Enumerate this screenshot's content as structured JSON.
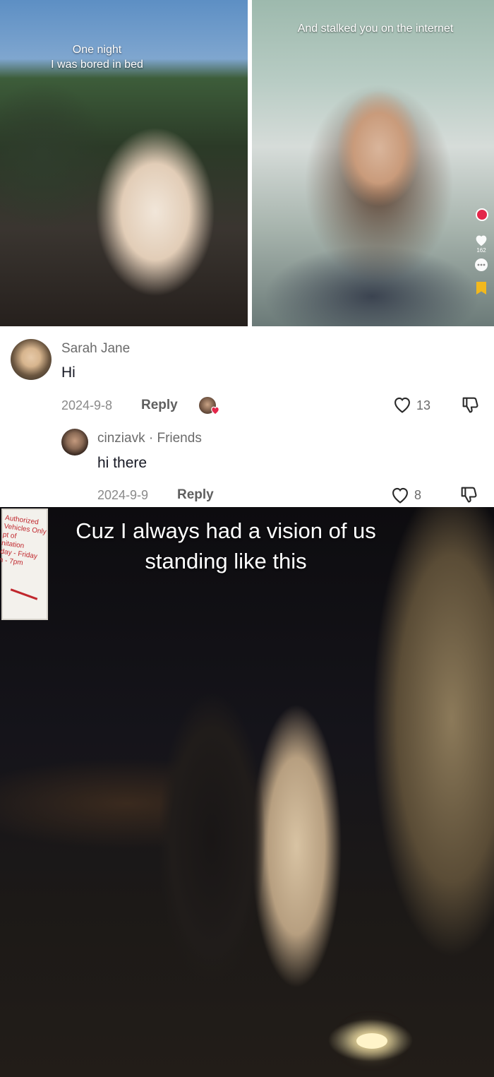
{
  "top_left_photo": {
    "caption": "One night\nI was bored in bed"
  },
  "top_right_photo": {
    "caption": "And stalked you on the internet",
    "side_rail": {
      "likes_count": "162"
    }
  },
  "comments": [
    {
      "author": "Sarah Jane",
      "text": "Hi",
      "date": "2024-9-8",
      "reply_label": "Reply",
      "like_count": "13"
    },
    {
      "author": "cinziavk",
      "relation": "· Friends",
      "text": "hi there",
      "date": "2024-9-9",
      "reply_label": "Reply",
      "like_count": "8"
    }
  ],
  "bottom_photo": {
    "caption": "Cuz I always had a vision of us standing like this",
    "sign_text": "Authorized Vehicles Only\npt of\nnitation\nday - Friday\nn - 7pm"
  },
  "colors": {
    "text_primary": "#161823",
    "text_secondary": "#6b6b6b",
    "heart_red": "#e3264a",
    "bookmark_yellow": "#f2b81d"
  },
  "icons": [
    "heart-outline-icon",
    "thumbs-down-icon",
    "comment-dots-icon",
    "bookmark-icon",
    "liked-by-author-heart-icon"
  ]
}
